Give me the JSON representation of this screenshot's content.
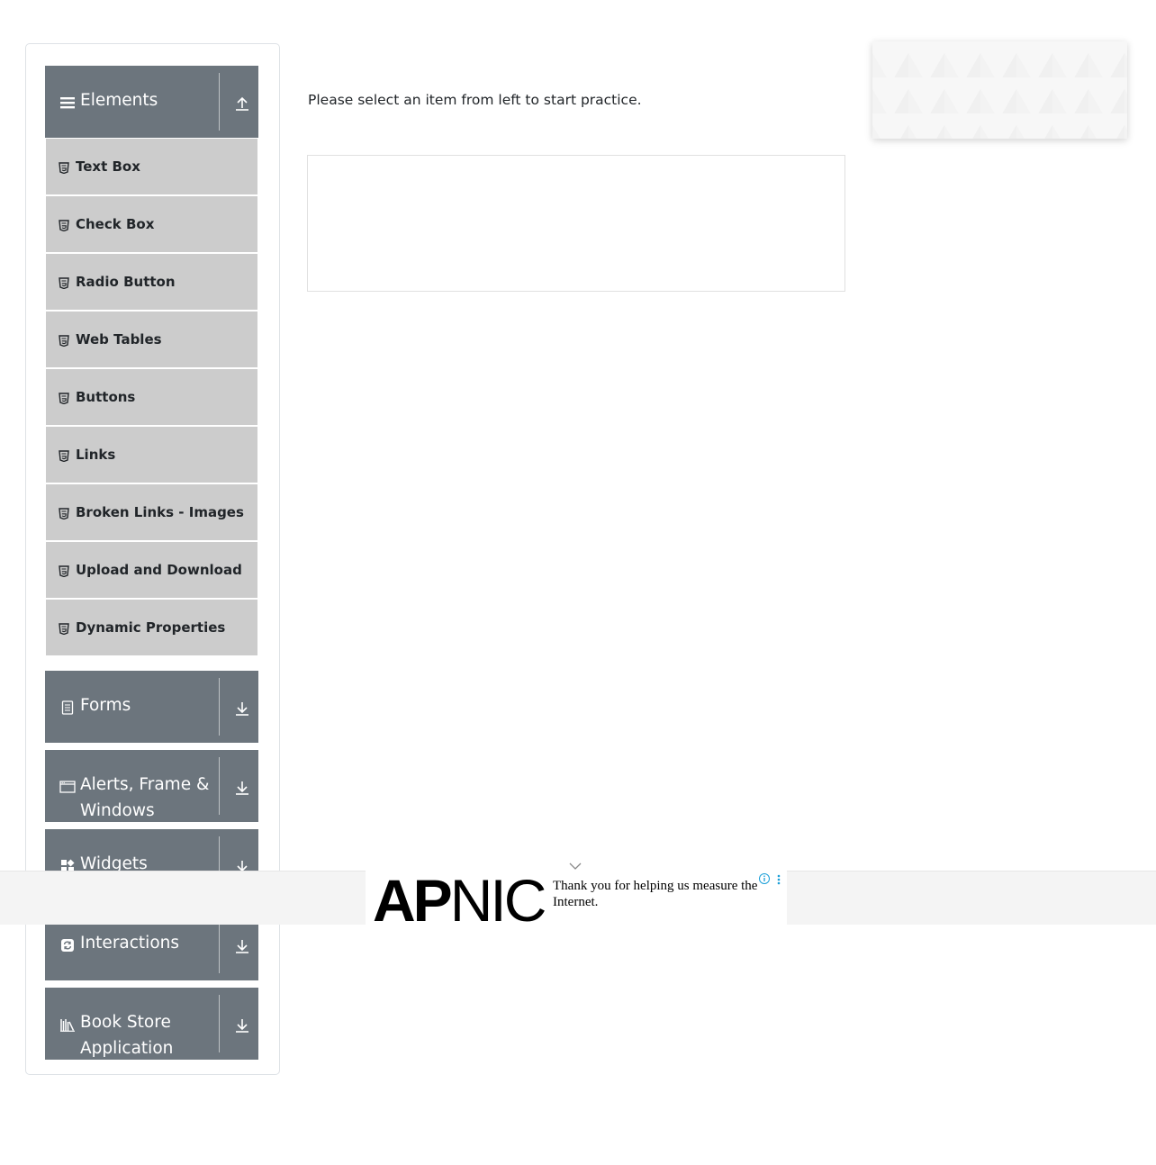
{
  "sidebar": {
    "groups": [
      {
        "title": "Elements",
        "icon": "hamburger-icon",
        "arrow": "collapse-up-arrow-icon"
      },
      {
        "title": "Forms",
        "icon": "form-document-icon",
        "arrow": "expand-down-arrow-icon"
      },
      {
        "title": "Alerts, Frame & Windows",
        "icon": "window-icon",
        "arrow": "expand-down-arrow-icon"
      },
      {
        "title": "Widgets",
        "icon": "widgets-icon",
        "arrow": "expand-down-arrow-icon"
      },
      {
        "title": "Interactions",
        "icon": "interactions-icon",
        "arrow": "expand-down-arrow-icon"
      },
      {
        "title": "Book Store Application",
        "icon": "bookshelf-icon",
        "arrow": "expand-down-arrow-icon"
      }
    ],
    "element_items": [
      {
        "label": "Text Box"
      },
      {
        "label": "Check Box"
      },
      {
        "label": "Radio Button"
      },
      {
        "label": "Web Tables"
      },
      {
        "label": "Buttons"
      },
      {
        "label": "Links"
      },
      {
        "label": "Broken Links - Images"
      },
      {
        "label": "Upload and Download"
      },
      {
        "label": "Dynamic Properties"
      }
    ],
    "item_icon": "html5-icon"
  },
  "main": {
    "instruction": "Please select an item from left to start practice."
  },
  "ad": {
    "logo_bold": "AP",
    "logo_light": "NIC",
    "message": "Thank you for helping us measure the Internet."
  },
  "colors": {
    "group_header_bg": "#6c757d",
    "menu_item_bg": "#cccccc",
    "text": "#212529"
  }
}
